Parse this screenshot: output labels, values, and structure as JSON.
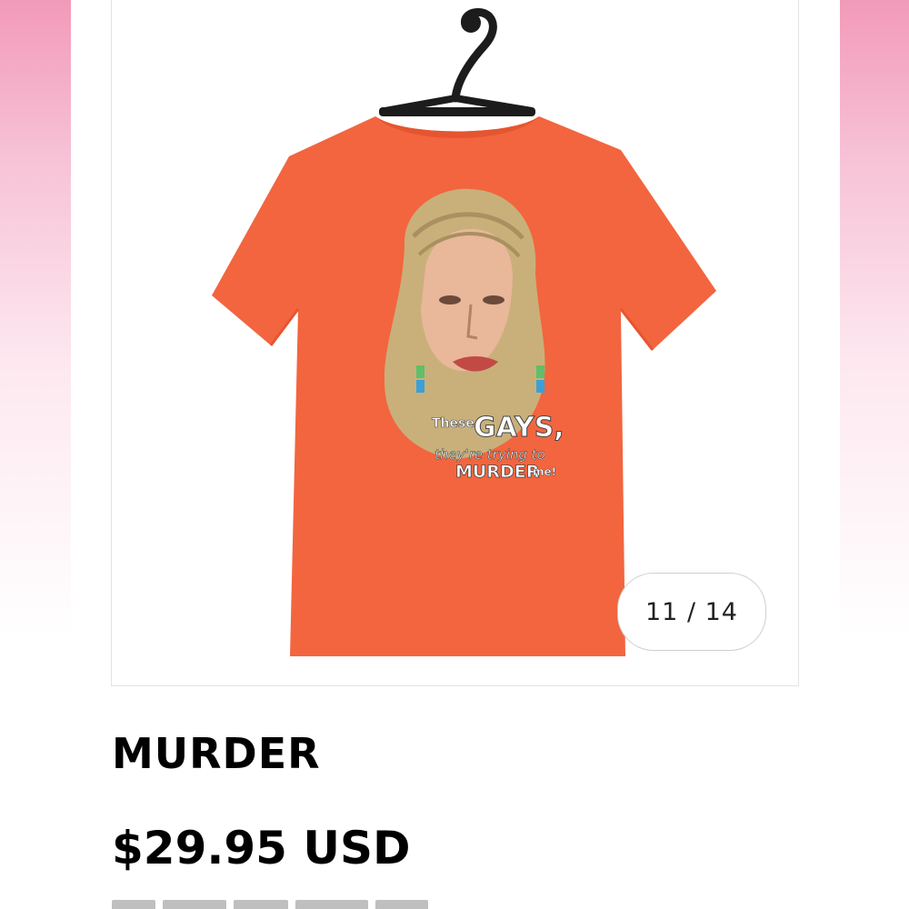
{
  "gallery": {
    "counter": "11 / 14",
    "image_alt": "Orange t-shirt on hanger with printed illustration",
    "print_text": {
      "line1_small": "These",
      "line1_big": "GAYS,",
      "line2": "they're trying to",
      "line3_big": "MURDER",
      "line3_small": "me!"
    }
  },
  "product": {
    "title": "MURDER",
    "price": "$29.95 USD"
  },
  "colors": {
    "shirt": "#f2653f",
    "shirt_shadow": "#e5552f",
    "hanger": "#1c1c1c",
    "hair": "#c9b07a",
    "skin": "#e9b79a"
  },
  "icons": {
    "hanger": "hanger-icon"
  }
}
